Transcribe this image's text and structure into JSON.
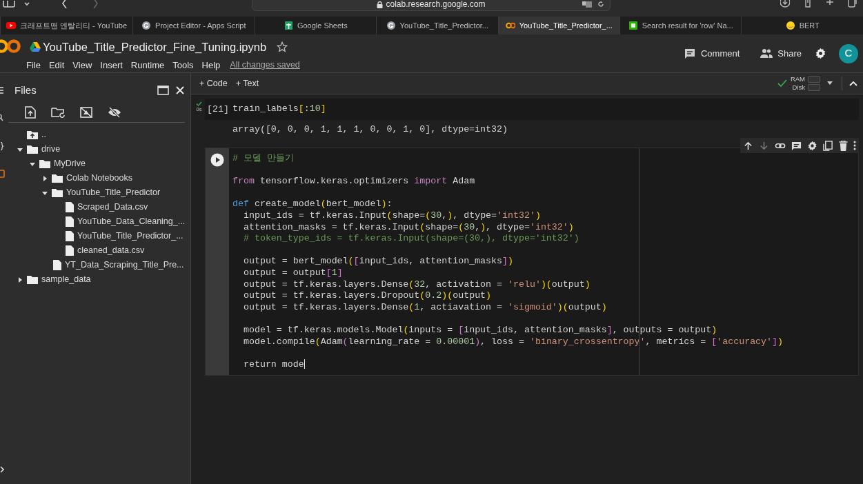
{
  "browser": {
    "address": "colab.research.google.com",
    "tabs": [
      {
        "kind": "youtube",
        "label": "크래프트맨 엔탈리티 - YouTube",
        "selected": false
      },
      {
        "kind": "g",
        "label": "Project Editor - Apps Script",
        "selected": false
      },
      {
        "kind": "sheets",
        "label": "Google Sheets",
        "selected": false
      },
      {
        "kind": "g",
        "label": "YouTube_Title_Predictor...",
        "selected": false
      },
      {
        "kind": "colab",
        "label": "YouTube_Title_Predictor_...",
        "selected": true
      },
      {
        "kind": "naver",
        "label": "Search result for 'row' Na...",
        "selected": false
      },
      {
        "kind": "hug",
        "label": "BERT",
        "selected": false
      }
    ]
  },
  "notebook": {
    "title": "YouTube_Title_Predictor_Fine_Tuning.ipynb",
    "starred": false,
    "menu": [
      "File",
      "Edit",
      "View",
      "Insert",
      "Runtime",
      "Tools",
      "Help"
    ],
    "save_status": "All changes saved",
    "actions": [
      {
        "kind": "comment",
        "label": "Comment"
      },
      {
        "kind": "share",
        "label": "Share"
      }
    ],
    "avatar": "C"
  },
  "toolbar": {
    "add_buttons": [
      "+ Code",
      "+ Text"
    ],
    "connected": true,
    "resources": [
      "RAM",
      "Disk"
    ]
  },
  "files": {
    "title": "Files",
    "tree": [
      {
        "kind": "up",
        "label": ".."
      },
      {
        "kind": "folder",
        "label": "drive",
        "expanded": true,
        "children": [
          {
            "kind": "folder",
            "label": "MyDrive",
            "expanded": true,
            "children": [
              {
                "kind": "folder",
                "label": "Colab Notebooks",
                "expanded": false
              },
              {
                "kind": "folder",
                "label": "YouTube_Title_Predictor",
                "expanded": true,
                "children": [
                  {
                    "kind": "file",
                    "label": "Scraped_Data.csv"
                  },
                  {
                    "kind": "file",
                    "label": "YouTube_Data_Cleaning_..."
                  },
                  {
                    "kind": "file",
                    "label": "YouTube_Title_Predictor_..."
                  },
                  {
                    "kind": "file",
                    "label": "cleaned_data.csv"
                  }
                ]
              },
              {
                "kind": "file",
                "label": "YT_Data_Scraping_Title_Pre..."
              }
            ]
          }
        ]
      },
      {
        "kind": "folder",
        "label": "sample_data",
        "expanded": false
      }
    ]
  },
  "cells": [
    {
      "kind": "executed",
      "status": "0s",
      "count": "[21]",
      "blocks": [
        [
          [
            {
              "kind": "plain",
              "text": "train_labels"
            },
            {
              "kind": "gold",
              "text": "["
            },
            {
              "kind": "plain",
              "text": ":"
            },
            {
              "kind": "number",
              "text": "10"
            },
            {
              "kind": "gold",
              "text": "]"
            }
          ]
        ]
      ],
      "output": "array([0, 0, 0, 1, 1, 1, 0, 0, 1, 0], dtype=int32)"
    },
    {
      "kind": "active",
      "blocks": [
        [
          [
            {
              "kind": "comment",
              "text": "# 모델 만들기"
            }
          ]
        ],
        [
          [
            {
              "kind": "keyword",
              "text": "from"
            },
            {
              "kind": "plain",
              "text": " tensorflow.keras.optimizers "
            },
            {
              "kind": "keyword",
              "text": "import"
            },
            {
              "kind": "plain",
              "text": " Adam"
            }
          ]
        ],
        [
          [
            {
              "kind": "def",
              "text": "def"
            },
            {
              "kind": "plain",
              "text": " create_model"
            },
            {
              "kind": "gold",
              "text": "("
            },
            {
              "kind": "plain",
              "text": "bert_model"
            },
            {
              "kind": "gold",
              "text": ")"
            },
            {
              "kind": "plain",
              "text": ":"
            }
          ],
          [
            {
              "kind": "plain",
              "text": "  input_ids = tf.keras.Input"
            },
            {
              "kind": "gold",
              "text": "("
            },
            {
              "kind": "plain",
              "text": "shape="
            },
            {
              "kind": "gold",
              "text": "("
            },
            {
              "kind": "number",
              "text": "30"
            },
            {
              "kind": "plain",
              "text": ","
            },
            {
              "kind": "gold",
              "text": ")"
            },
            {
              "kind": "plain",
              "text": ", dtype="
            },
            {
              "kind": "string",
              "text": "'int32'"
            },
            {
              "kind": "gold",
              "text": ")"
            }
          ],
          [
            {
              "kind": "plain",
              "text": "  attention_masks = tf.keras.Input"
            },
            {
              "kind": "gold",
              "text": "("
            },
            {
              "kind": "plain",
              "text": "shape="
            },
            {
              "kind": "gold",
              "text": "("
            },
            {
              "kind": "number",
              "text": "30"
            },
            {
              "kind": "plain",
              "text": ","
            },
            {
              "kind": "gold",
              "text": ")"
            },
            {
              "kind": "plain",
              "text": ", dtype="
            },
            {
              "kind": "string",
              "text": "'int32'"
            },
            {
              "kind": "gold",
              "text": ")"
            }
          ],
          [
            {
              "kind": "comment",
              "text": "  # token_type_ids = tf.keras.Input(shape=(30,), dtype='int32')"
            }
          ]
        ],
        [
          [
            {
              "kind": "plain",
              "text": "  output = bert_model"
            },
            {
              "kind": "gold",
              "text": "("
            },
            {
              "kind": "violet",
              "text": "["
            },
            {
              "kind": "plain",
              "text": "input_ids, attention_masks"
            },
            {
              "kind": "violet",
              "text": "]"
            },
            {
              "kind": "gold",
              "text": ")"
            }
          ],
          [
            {
              "kind": "plain",
              "text": "  output = output"
            },
            {
              "kind": "violet",
              "text": "["
            },
            {
              "kind": "number",
              "text": "1"
            },
            {
              "kind": "violet",
              "text": "]"
            }
          ],
          [
            {
              "kind": "plain",
              "text": "  output = tf.keras.layers.Dense"
            },
            {
              "kind": "gold",
              "text": "("
            },
            {
              "kind": "number",
              "text": "32"
            },
            {
              "kind": "plain",
              "text": ", activation = "
            },
            {
              "kind": "string",
              "text": "'relu'"
            },
            {
              "kind": "gold",
              "text": ")("
            },
            {
              "kind": "plain",
              "text": "output"
            },
            {
              "kind": "gold",
              "text": ")"
            }
          ],
          [
            {
              "kind": "plain",
              "text": "  output = tf.keras.layers.Dropout"
            },
            {
              "kind": "gold",
              "text": "("
            },
            {
              "kind": "number",
              "text": "0.2"
            },
            {
              "kind": "gold",
              "text": ")("
            },
            {
              "kind": "plain",
              "text": "output"
            },
            {
              "kind": "gold",
              "text": ")"
            }
          ],
          [
            {
              "kind": "plain",
              "text": "  output = tf.keras.layers.Dense"
            },
            {
              "kind": "gold",
              "text": "("
            },
            {
              "kind": "number",
              "text": "1"
            },
            {
              "kind": "plain",
              "text": ", actiavation = "
            },
            {
              "kind": "string",
              "text": "'sigmoid'"
            },
            {
              "kind": "gold",
              "text": ")("
            },
            {
              "kind": "plain",
              "text": "output"
            },
            {
              "kind": "gold",
              "text": ")"
            }
          ]
        ],
        [
          [
            {
              "kind": "plain",
              "text": "  model = tf.keras.models.Model"
            },
            {
              "kind": "gold",
              "text": "("
            },
            {
              "kind": "plain",
              "text": "inputs = "
            },
            {
              "kind": "violet",
              "text": "["
            },
            {
              "kind": "plain",
              "text": "input_ids, attention_masks"
            },
            {
              "kind": "violet",
              "text": "]"
            },
            {
              "kind": "plain",
              "text": ", outputs = output"
            },
            {
              "kind": "gold",
              "text": ")"
            }
          ],
          [
            {
              "kind": "plain",
              "text": "  model.compile"
            },
            {
              "kind": "gold",
              "text": "("
            },
            {
              "kind": "plain",
              "text": "Adam"
            },
            {
              "kind": "violet",
              "text": "("
            },
            {
              "kind": "plain",
              "text": "learning_rate = "
            },
            {
              "kind": "number",
              "text": "0.00001"
            },
            {
              "kind": "violet",
              "text": ")"
            },
            {
              "kind": "plain",
              "text": ", loss = "
            },
            {
              "kind": "string",
              "text": "'binary_crossentropy'"
            },
            {
              "kind": "plain",
              "text": ", metrics = "
            },
            {
              "kind": "violet",
              "text": "["
            },
            {
              "kind": "string",
              "text": "'accuracy'"
            },
            {
              "kind": "violet",
              "text": "]"
            },
            {
              "kind": "gold",
              "text": ")"
            }
          ]
        ],
        [
          [
            {
              "kind": "plain",
              "text": "  return mode"
            }
          ]
        ]
      ]
    }
  ]
}
